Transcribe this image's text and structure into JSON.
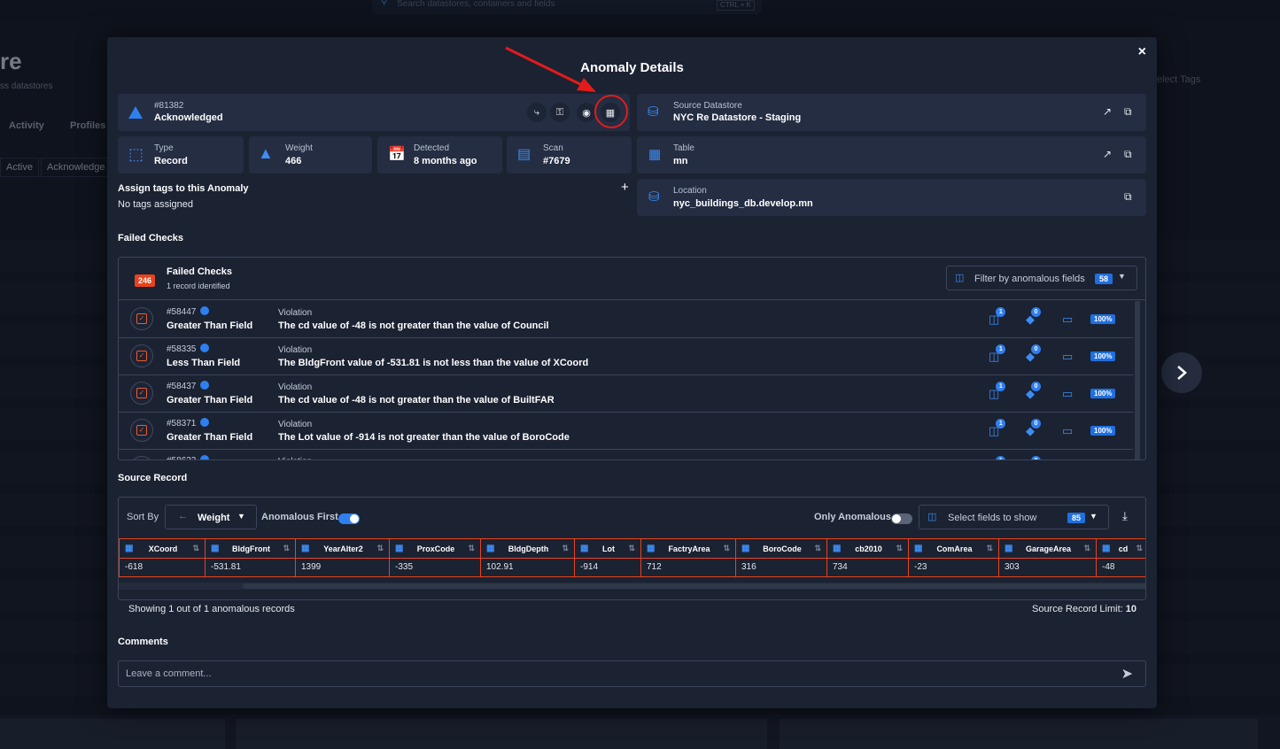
{
  "background": {
    "search_placeholder": "Search datastores, containers and fields",
    "search_shortcut": "CTRL + K",
    "page_title_fragment": "re",
    "page_subtitle_fragment": "ss datastores",
    "tabs": [
      "Activity",
      "Profiles"
    ],
    "chips": [
      "Active",
      "Acknowledge"
    ],
    "tags_placeholder_fragment": "elect Tags"
  },
  "modal": {
    "title": "Anomaly Details",
    "close_label": "×",
    "anomaly": {
      "id": "#81382",
      "status": "Acknowledged"
    },
    "source_datastore": {
      "label": "Source Datastore",
      "value": "NYC Re Datastore - Staging"
    },
    "type": {
      "label": "Type",
      "value": "Record"
    },
    "weight": {
      "label": "Weight",
      "value": "466"
    },
    "detected": {
      "label": "Detected",
      "value": "8 months ago"
    },
    "scan": {
      "label": "Scan",
      "value": "#7679"
    },
    "table": {
      "label": "Table",
      "value": "mn"
    },
    "location": {
      "label": "Location",
      "value": "nyc_buildings_db.develop.mn"
    },
    "tags": {
      "title": "Assign tags to this Anomaly",
      "empty": "No tags assigned",
      "add_label": "+"
    },
    "failed_checks": {
      "section_title": "Failed Checks",
      "count_badge": "246",
      "header_title": "Failed Checks",
      "header_sub": "1 record identified",
      "filter_label": "Filter by anomalous fields",
      "filter_count": "58",
      "violation_label": "Violation",
      "rows": [
        {
          "id": "#58447",
          "name": "Greater Than Field",
          "violation": "The cd value of -48 is not greater than the value of Council",
          "b1": "1",
          "b2": "0",
          "pct": "100%"
        },
        {
          "id": "#58335",
          "name": "Less Than Field",
          "violation": "The BldgFront value of -531.81 is not less than the value of XCoord",
          "b1": "1",
          "b2": "0",
          "pct": "100%"
        },
        {
          "id": "#58437",
          "name": "Greater Than Field",
          "violation": "The cd value of -48 is not greater than the value of BuiltFAR",
          "b1": "1",
          "b2": "0",
          "pct": "100%"
        },
        {
          "id": "#58371",
          "name": "Greater Than Field",
          "violation": "The Lot value of -914 is not greater than the value of BoroCode",
          "b1": "1",
          "b2": "0",
          "pct": "100%"
        },
        {
          "id": "#58632",
          "name": "",
          "violation": "",
          "b1": "1",
          "b2": "0",
          "pct": ""
        }
      ]
    },
    "source_record": {
      "section_title": "Source Record",
      "sort_by_label": "Sort By",
      "sort_value": "Weight",
      "anomalous_first_label": "Anomalous First",
      "only_anomalous_label": "Only Anomalous",
      "select_fields_label": "Select fields to show",
      "select_fields_count": "85",
      "columns": [
        {
          "name": "XCoord",
          "value": "-618"
        },
        {
          "name": "BldgFront",
          "value": "-531.81"
        },
        {
          "name": "YearAlter2",
          "value": "1399"
        },
        {
          "name": "ProxCode",
          "value": "-335"
        },
        {
          "name": "BldgDepth",
          "value": "102.91"
        },
        {
          "name": "Lot",
          "value": "-914"
        },
        {
          "name": "FactryArea",
          "value": "712"
        },
        {
          "name": "BoroCode",
          "value": "316"
        },
        {
          "name": "cb2010",
          "value": "734"
        },
        {
          "name": "ComArea",
          "value": "-23"
        },
        {
          "name": "GarageArea",
          "value": "303"
        },
        {
          "name": "cd",
          "value": "-48"
        }
      ],
      "showing_text": "Showing 1 out of 1 anomalous records",
      "limit_text": "Source Record Limit: ",
      "limit_value": "10"
    },
    "comments": {
      "section_title": "Comments",
      "placeholder": "Leave a comment..."
    }
  },
  "colors": {
    "accent": "#2f7fee",
    "danger": "#e8431c",
    "annotation": "#e31b1b",
    "bg": "#1b2232"
  }
}
